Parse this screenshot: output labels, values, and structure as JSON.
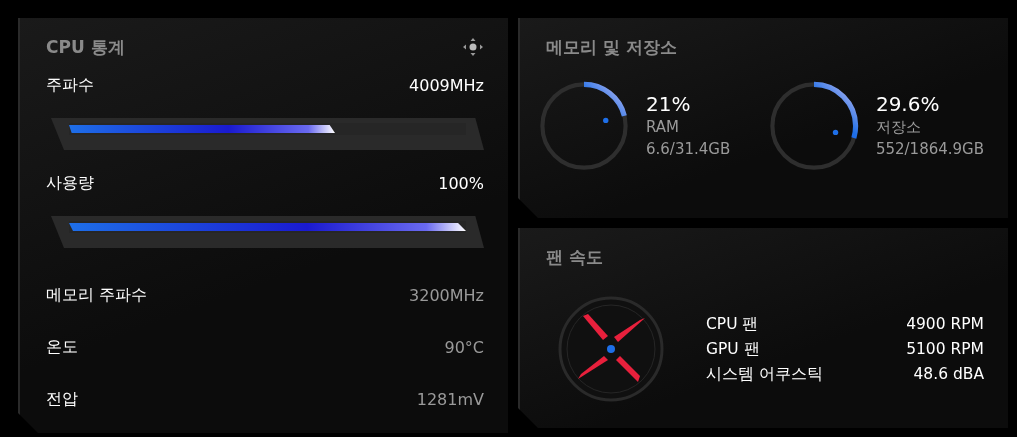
{
  "cpu_stats": {
    "title": "CPU 통계",
    "rows": [
      {
        "kind": "bar",
        "label": "주파수",
        "value": "4009MHz",
        "level": 0.67
      },
      {
        "kind": "bar",
        "label": "사용량",
        "value": "100%",
        "level": 1
      },
      {
        "kind": "plain",
        "label": "메모리 주파수",
        "value": "3200MHz"
      },
      {
        "kind": "plain",
        "label": "온도",
        "value": "90°C"
      },
      {
        "kind": "plain",
        "label": "전압",
        "value": "1281mV"
      }
    ]
  },
  "memory_storage": {
    "title": "메모리 및 저장소",
    "gauges": [
      {
        "percent": "21%",
        "label": "RAM",
        "usage": "6.6/31.4GB"
      },
      {
        "percent": "29.6%",
        "label": "저장소",
        "usage": "552/1864.9GB"
      }
    ]
  },
  "fan_speed": {
    "title": "팬 속도",
    "rows": [
      {
        "label": "CPU 팬",
        "value": "4900 RPM"
      },
      {
        "label": "GPU 팬",
        "value": "5100 RPM"
      },
      {
        "label": "시스템 어쿠스틱",
        "value": "48.6 dBA"
      }
    ]
  }
}
